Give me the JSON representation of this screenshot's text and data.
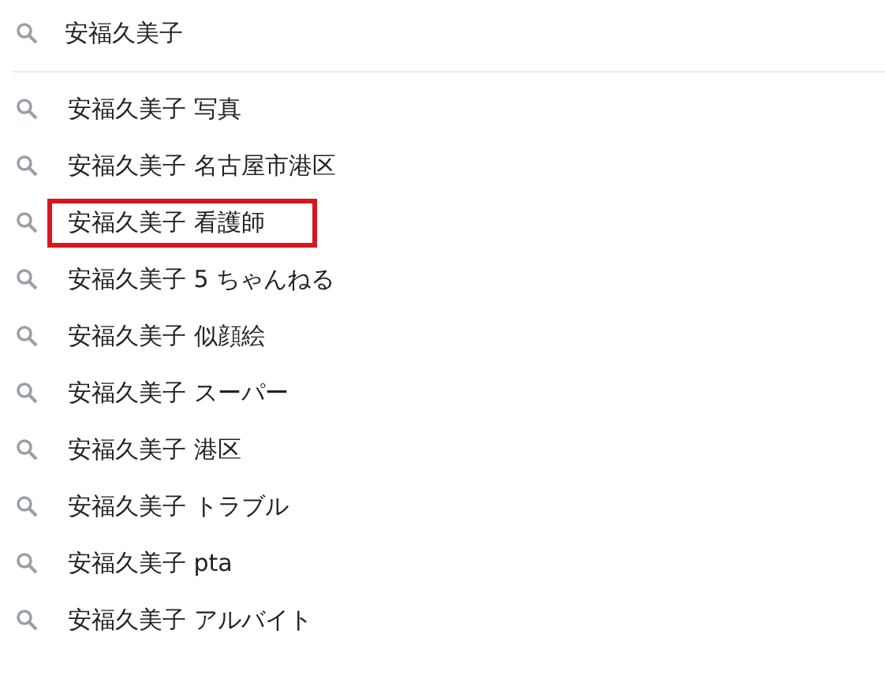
{
  "search": {
    "value": "安福久美子"
  },
  "suggestions": [
    {
      "text": "安福久美子 写真",
      "highlighted": false
    },
    {
      "text": "安福久美子 名古屋市港区",
      "highlighted": false
    },
    {
      "text": "安福久美子 看護師",
      "highlighted": true
    },
    {
      "text": "安福久美子 5 ちゃんねる",
      "highlighted": false
    },
    {
      "text": "安福久美子 似顔絵",
      "highlighted": false
    },
    {
      "text": "安福久美子 スーパー",
      "highlighted": false
    },
    {
      "text": "安福久美子 港区",
      "highlighted": false
    },
    {
      "text": "安福久美子 トラブル",
      "highlighted": false
    },
    {
      "text": "安福久美子 pta",
      "highlighted": false
    },
    {
      "text": "安福久美子 アルバイト",
      "highlighted": false
    }
  ]
}
